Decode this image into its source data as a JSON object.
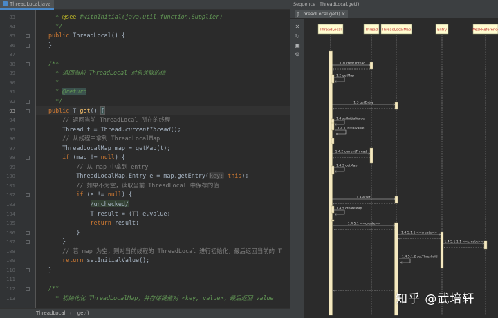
{
  "editor": {
    "tab_label": "ThreadLocal.java",
    "lines": [
      {
        "no": "83",
        "segs": [
          [
            "cm",
            "  * "
          ],
          [
            "an",
            "@see"
          ],
          [
            "cm",
            " #withInitial(java.util.function.Supplier)"
          ]
        ]
      },
      {
        "no": "84",
        "segs": [
          [
            "cm",
            "  */"
          ]
        ]
      },
      {
        "no": "85",
        "segs": [
          [
            "kw",
            "public "
          ],
          [
            "",
            "ThreadLocal() {"
          ]
        ]
      },
      {
        "no": "86",
        "segs": [
          [
            "",
            "}"
          ]
        ]
      },
      {
        "no": "87",
        "segs": [
          [
            "",
            ""
          ]
        ]
      },
      {
        "no": "88",
        "segs": [
          [
            "cm",
            "/**"
          ]
        ]
      },
      {
        "no": "89",
        "segs": [
          [
            "cm",
            "  * 返回当前 ThreadLocal 对象关联的值"
          ]
        ]
      },
      {
        "no": "90",
        "segs": [
          [
            "cm",
            "  *"
          ]
        ]
      },
      {
        "no": "91",
        "segs": [
          [
            "cm",
            "  * "
          ],
          [
            "rt",
            "@return"
          ]
        ]
      },
      {
        "no": "92",
        "segs": [
          [
            "cm",
            "  */"
          ]
        ]
      },
      {
        "no": "93",
        "segs": [
          [
            "kw",
            "public "
          ],
          [
            "",
            "T "
          ],
          [
            "mth",
            "get"
          ],
          [
            "",
            "() "
          ],
          [
            "brace",
            "{"
          ]
        ]
      },
      {
        "no": "94",
        "segs": [
          [
            "lc",
            "    // 返回当前 ThreadLocal 所在的线程"
          ]
        ]
      },
      {
        "no": "95",
        "segs": [
          [
            "",
            "    Thread t = Thread."
          ],
          [
            "it",
            "currentThread"
          ],
          [
            "",
            "();"
          ]
        ]
      },
      {
        "no": "96",
        "segs": [
          [
            "lc",
            "    // 从线程中拿到 ThreadLocalMap"
          ]
        ]
      },
      {
        "no": "97",
        "segs": [
          [
            "",
            "    ThreadLocalMap map = getMap(t);"
          ]
        ]
      },
      {
        "no": "98",
        "segs": [
          [
            "",
            "    "
          ],
          [
            "kw",
            "if "
          ],
          [
            "",
            "(map != "
          ],
          [
            "kw",
            "null"
          ],
          [
            "",
            ") {"
          ]
        ]
      },
      {
        "no": "99",
        "segs": [
          [
            "lc",
            "        // 从 map 中拿到 entry"
          ]
        ]
      },
      {
        "no": "100",
        "segs": [
          [
            "",
            "        ThreadLocalMap.Entry e = map.getEntry("
          ],
          [
            "hint",
            "key:"
          ],
          [
            "",
            " "
          ],
          [
            "kw",
            "this"
          ],
          [
            "",
            ");"
          ]
        ]
      },
      {
        "no": "101",
        "segs": [
          [
            "lc",
            "        // 如果不为空，读取当前 ThreadLocal 中保存的值"
          ]
        ]
      },
      {
        "no": "102",
        "segs": [
          [
            "",
            "        "
          ],
          [
            "kw",
            "if "
          ],
          [
            "",
            "(e != "
          ],
          [
            "kw",
            "null"
          ],
          [
            "",
            ") {"
          ]
        ]
      },
      {
        "no": "103",
        "segs": [
          [
            "",
            "            "
          ],
          [
            "unch",
            "/unchecked/"
          ]
        ]
      },
      {
        "no": "104",
        "segs": [
          [
            "",
            "            T result = ("
          ],
          [
            "dim",
            "T"
          ],
          [
            "",
            ") e.value;"
          ]
        ]
      },
      {
        "no": "105",
        "segs": [
          [
            "",
            "            "
          ],
          [
            "kw",
            "return "
          ],
          [
            "",
            "result;"
          ]
        ]
      },
      {
        "no": "106",
        "segs": [
          [
            "",
            "        }"
          ]
        ]
      },
      {
        "no": "107",
        "segs": [
          [
            "",
            "    }"
          ]
        ]
      },
      {
        "no": "108",
        "segs": [
          [
            "lc",
            "    // 若 map 为空，则对当前线程的 ThreadLocal 进行初始化，最后返回当前的 T"
          ]
        ]
      },
      {
        "no": "109",
        "segs": [
          [
            "",
            "    "
          ],
          [
            "kw",
            "return "
          ],
          [
            "",
            "setInitialValue();"
          ]
        ]
      },
      {
        "no": "110",
        "segs": [
          [
            "",
            "}"
          ]
        ]
      },
      {
        "no": "111",
        "segs": [
          [
            "",
            ""
          ]
        ]
      },
      {
        "no": "112",
        "segs": [
          [
            "cm",
            "/**"
          ]
        ]
      },
      {
        "no": "113",
        "segs": [
          [
            "cm",
            "  * 初始化化 ThreadLocalMap，并存储键值对 <key, value>，最后返回 value"
          ]
        ]
      }
    ],
    "current_line": "93"
  },
  "statusbar": {
    "crumb1": "ThreadLocal",
    "crumb2": "get()"
  },
  "sequence": {
    "tab_sequence": "Sequence",
    "tab_title": "ThreadLocal.get()",
    "subtab_label": "ThreadLocal.get()",
    "participants": [
      "ThreadLocal",
      "Thread",
      "ThreadLocalMap",
      "Entry",
      "WeakReference"
    ],
    "messages": [
      {
        "label": "1.1 currentThread"
      },
      {
        "label": "1.2 getMap"
      },
      {
        "label": "1.3 getEntry"
      },
      {
        "label": "1.4 setInitialValue"
      },
      {
        "label": "1.4.1 initialValue"
      },
      {
        "label": "1.4.2 currentThread"
      },
      {
        "label": "1.4.3 getMap"
      },
      {
        "label": "1.4.4 set"
      },
      {
        "label": "1.4.5 createMap"
      },
      {
        "label": "1.4.5.1 <<create>>"
      },
      {
        "label": "1.4.5.1.1 <<create>>"
      },
      {
        "label": "1.4.5.1.1.1 <<create>>"
      },
      {
        "label": "1.4.5.1.2 setThreshold"
      }
    ],
    "colors": {
      "participant_fill": "#fffcd0",
      "activation_fill": "#f5e9c0",
      "lifeline": "#8a8a8a",
      "arrow": "#cfcfcf"
    }
  },
  "watermark": "知乎 @武培轩"
}
